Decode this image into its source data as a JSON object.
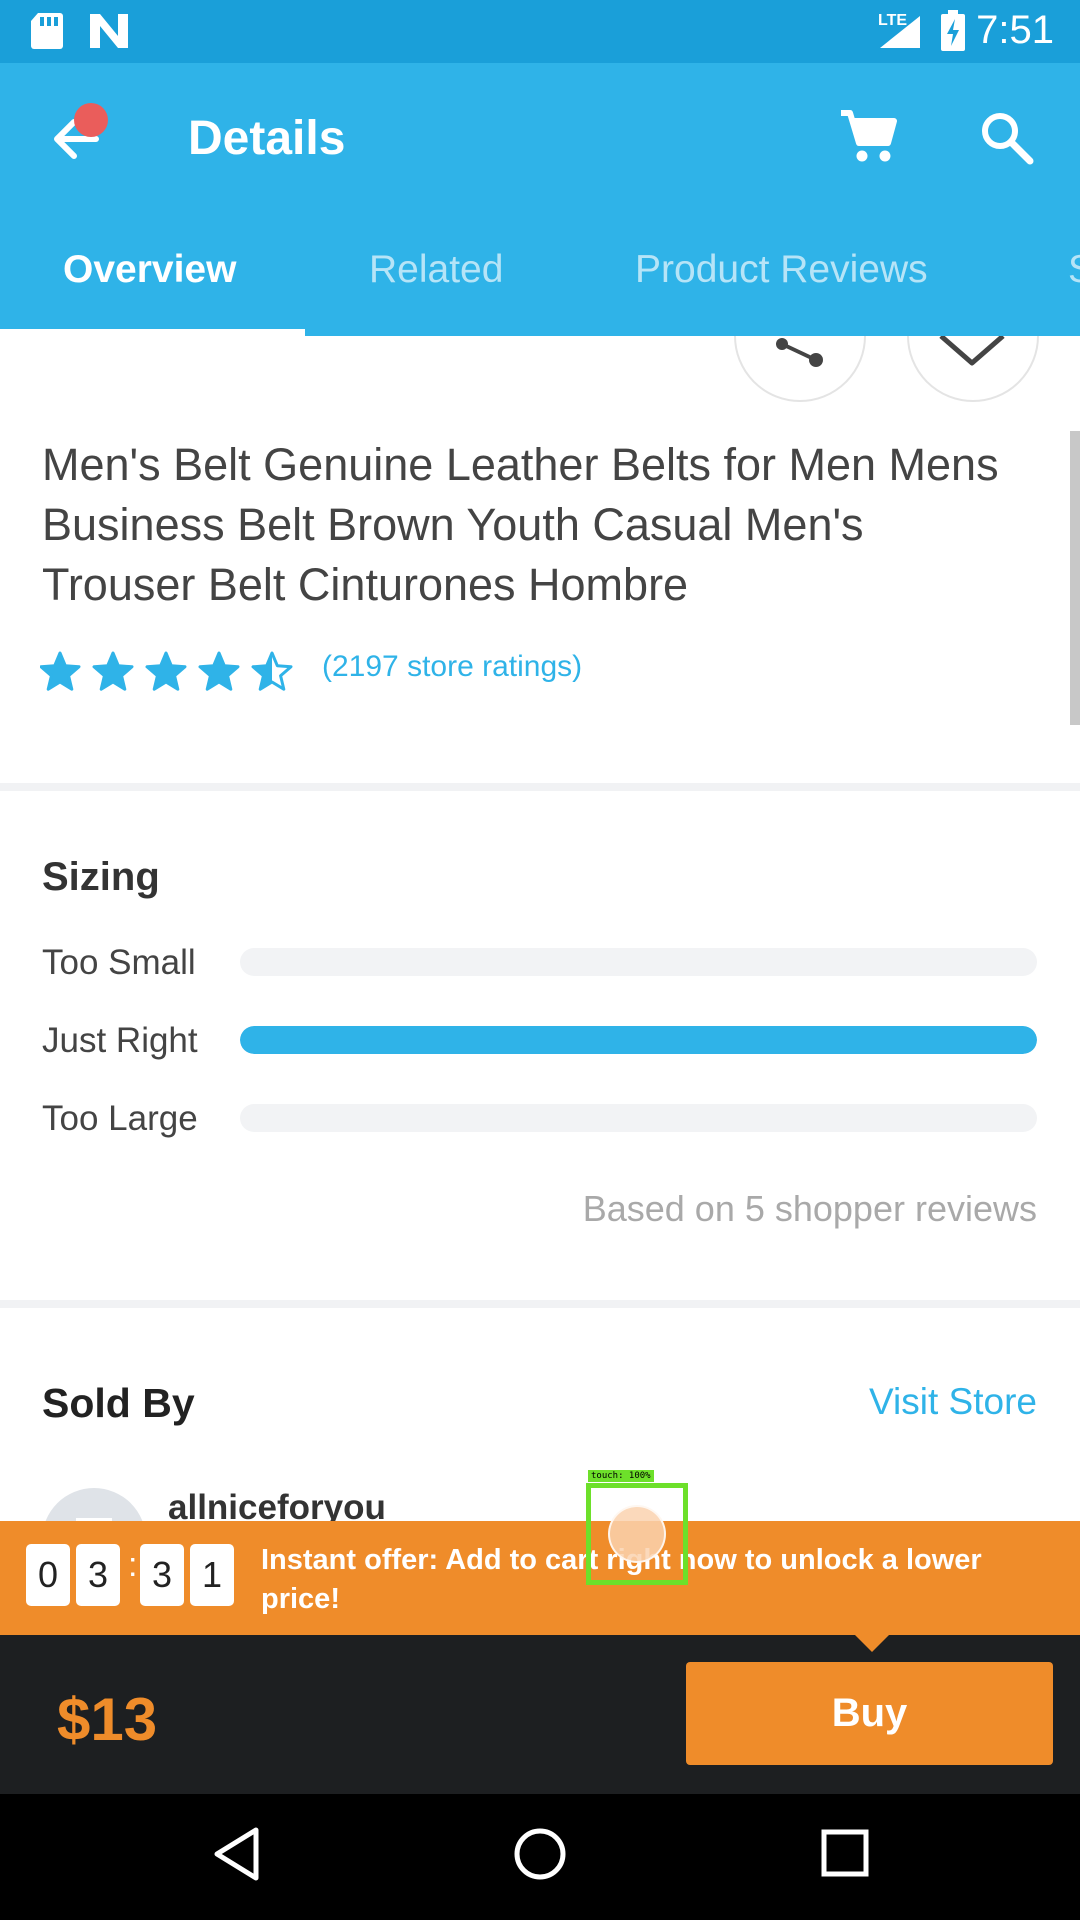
{
  "status_bar": {
    "time": "7:51",
    "network": "LTE",
    "icons": [
      "sd-card-icon",
      "n-notification-icon",
      "signal-icon",
      "battery-charging-icon"
    ]
  },
  "app_bar": {
    "title": "Details",
    "back_icon": "back-arrow-icon",
    "cart_icon": "cart-icon",
    "search_icon": "search-icon",
    "tabs": [
      {
        "label": "Overview",
        "active": true
      },
      {
        "label": "Related",
        "active": false
      },
      {
        "label": "Product Reviews",
        "active": false
      },
      {
        "label": "S",
        "active": false
      }
    ]
  },
  "actions": {
    "share_icon": "share-icon",
    "wishlist_icon": "heart-icon"
  },
  "product": {
    "title": "Men's Belt Genuine Leather Belts for Men Mens Business Belt Brown Youth Casual Men's Trouser Belt Cinturones Hombre",
    "rating": 4.5,
    "rating_max": 5,
    "ratings_text": "(2197 store ratings)"
  },
  "sizing": {
    "heading": "Sizing",
    "rows": [
      {
        "label": "Too Small",
        "fraction": 0.0
      },
      {
        "label": "Just Right",
        "fraction": 1.0
      },
      {
        "label": "Too Large",
        "fraction": 0.0
      }
    ],
    "footnote": "Based on 5 shopper reviews"
  },
  "sold_by": {
    "heading": "Sold By",
    "visit_store": "Visit Store",
    "store_name": "allniceforyou"
  },
  "offer": {
    "timer_digits": [
      "0",
      "3",
      "3",
      "1"
    ],
    "separator": ":",
    "text": "Instant offer: Add to cart right now to unlock a lower price!"
  },
  "bottom_bar": {
    "price": "$13",
    "buy_label": "Buy"
  },
  "nav_bar": {
    "icons": [
      "nav-back-icon",
      "nav-home-icon",
      "nav-recents-icon"
    ]
  },
  "touch_overlay": {
    "label": "touch: 100%"
  },
  "colors": {
    "primary": "#2fb3e8",
    "status_bar": "#1a9fd9",
    "accent": "#ef8c2a",
    "bottom_bar": "#1d1f21",
    "star": "#2fb3e8"
  }
}
